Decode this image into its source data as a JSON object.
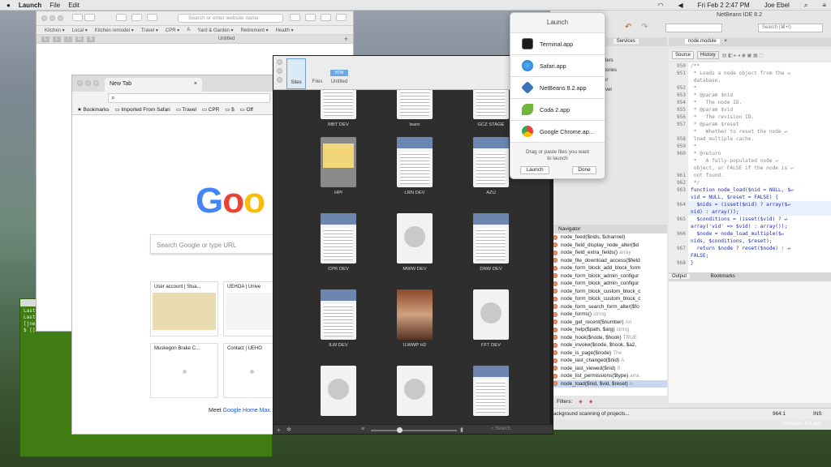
{
  "menubar": {
    "app": "Launch",
    "file": "File",
    "edit": "Edit",
    "datetime": "Fri Feb 2  2:47 PM",
    "user": "Joe Ebel"
  },
  "safari": {
    "address_placeholder": "Search or enter website name",
    "bookmarks": [
      "Kitchen ▾",
      "Local ▾",
      "Kitchen remodel ▾",
      "Travel ▾",
      "CPR ▾",
      "A",
      "Yard & Garden ▾",
      "Retirement ▾",
      "Health ▾"
    ],
    "tab_title": "Untitled",
    "tabicons": [
      "L",
      "L",
      "I",
      "G",
      "S"
    ]
  },
  "chrome": {
    "tab_title": "New Tab",
    "bookmarks": [
      "Bookmarks",
      "Imported From Safari",
      "Travel",
      "CPR",
      "$",
      "Off"
    ],
    "search_placeholder": "Search Google or type URL",
    "tiles": [
      "User account | Stua...",
      "UEHOA | Unive",
      "Muskegon Brake C...",
      "Contact | UEHO"
    ],
    "footer_prefix": "Meet ",
    "footer_link": "Google Home Max."
  },
  "terminal": {
    "lines": [
      "Last",
      "Last",
      "[jne",
      "$ []"
    ]
  },
  "coda": {
    "tabs": [
      "Sites",
      "Files",
      "Untitled"
    ],
    "tab3_badge": "HTM",
    "search_placeholder": "Search",
    "tiles": [
      "MBT DEV",
      "learn",
      "GCZ STAGE",
      "HPI",
      "LRN DEV",
      "AZU",
      "CPR DEV",
      "MWW DEV",
      "DNW DEV",
      "ILW DEV",
      "ILWWP H2",
      "FFT DEV",
      "",
      "",
      ""
    ]
  },
  "launch_popover": {
    "title": "Launch",
    "apps": [
      "Terminal.app",
      "Safari.app",
      "NetBeans 8.2.app",
      "Coda 2.app",
      "Google Chrome.ap..."
    ],
    "hint": "Drag or paste files you want to launch",
    "launch_button": "Launch",
    "done_button": "Done"
  },
  "netbeans": {
    "title": "NetBeans IDE 8.2",
    "search_placeholder": "Search (⌘+I)",
    "tabs": [
      "phd",
      "Services",
      "node.module"
    ],
    "source_tab": "Source",
    "history_tab": "History",
    "services_items": [
      "ders",
      "itories",
      "er",
      "rver"
    ],
    "navigator_title": "Navigator",
    "navigator_items": [
      {
        "n": "node_feed($nids, $channel)",
        "t": ""
      },
      {
        "n": "node_field_display_node_alter($d",
        "t": ""
      },
      {
        "n": "node_field_extra_fields()",
        "t": "array"
      },
      {
        "n": "node_file_download_access($field",
        "t": ""
      },
      {
        "n": "node_form_block_add_block_form",
        "t": ""
      },
      {
        "n": "node_form_block_admin_configur",
        "t": ""
      },
      {
        "n": "node_form_block_admin_configur",
        "t": ""
      },
      {
        "n": "node_form_block_custom_block_c",
        "t": ""
      },
      {
        "n": "node_form_block_custom_block_c",
        "t": ""
      },
      {
        "n": "node_form_search_form_alter($fo",
        "t": ""
      },
      {
        "n": "node_forms()",
        "t": "string"
      },
      {
        "n": "node_get_recent($number)",
        "t": "An"
      },
      {
        "n": "node_help($path, $arg)",
        "t": "string"
      },
      {
        "n": "node_hook($node, $hook)",
        "t": "TRUE"
      },
      {
        "n": "node_invoke($node, $hook, $a2,",
        "t": ""
      },
      {
        "n": "node_is_page($node)",
        "t": "The"
      },
      {
        "n": "node_last_changed($nid)",
        "t": "A"
      },
      {
        "n": "node_last_viewed($nid)",
        "t": "If"
      },
      {
        "n": "node_list_permissions($type)",
        "t": "arra"
      },
      {
        "n": "node_load($nid, $vid, $reset)",
        "t": "A"
      }
    ],
    "filters_label": "Filters:",
    "output_tab": "Output",
    "bookmarks_tab": "Bookmarks",
    "status_text": "ackground scanning of projects...",
    "cursor_pos": "964:1",
    "mode": "INS",
    "dock_label": "NetBeans 8.2.app",
    "line_numbers": [
      "950",
      "951",
      "",
      "952",
      "953",
      "954",
      "955",
      "956",
      "957",
      "",
      "958",
      "959",
      "960",
      "",
      "",
      "961",
      "962",
      "963",
      "",
      "964",
      "",
      "965",
      "",
      "966",
      "",
      "967",
      "",
      "968"
    ],
    "code_lines": [
      {
        "c": "cm",
        "s": "/**"
      },
      {
        "c": "cm",
        "s": " * Loads a node object from the ↵"
      },
      {
        "c": "cm",
        "s": " database."
      },
      {
        "c": "cm",
        "s": " *"
      },
      {
        "c": "cm",
        "s": " * @param $nid"
      },
      {
        "c": "cm",
        "s": " *   The node ID."
      },
      {
        "c": "cm",
        "s": " * @param $vid"
      },
      {
        "c": "cm",
        "s": " *   The revision ID."
      },
      {
        "c": "cm",
        "s": " * @param $reset"
      },
      {
        "c": "cm",
        "s": " *   Whether to reset the node_↵"
      },
      {
        "c": "cm",
        "s": " load_multiple cache."
      },
      {
        "c": "cm",
        "s": " *"
      },
      {
        "c": "cm",
        "s": " * @return"
      },
      {
        "c": "cm",
        "s": " *   A fully-populated node ↵"
      },
      {
        "c": "cm",
        "s": " object, or FALSE if the node is ↵"
      },
      {
        "c": "cm",
        "s": " not found."
      },
      {
        "c": "cm",
        "s": " */"
      },
      {
        "c": "kw",
        "s": "function node_load($nid = NULL, $↵"
      },
      {
        "c": "kw",
        "s": "vid = NULL, $reset = FALSE) {"
      },
      {
        "c": "kw",
        "s": "  $nids = (isset($nid) ? array($↵"
      },
      {
        "c": "kw",
        "s": "nid) : array());"
      },
      {
        "c": "kw",
        "s": "  $conditions = (isset($vid) ? ↵"
      },
      {
        "c": "kw",
        "s": "array('vid' => $vid) : array());"
      },
      {
        "c": "kw",
        "s": "  $node = node_load_multiple($↵"
      },
      {
        "c": "kw",
        "s": "nids, $conditions, $reset);"
      },
      {
        "c": "kw",
        "s": "  return $node ? reset($node) : ↵"
      },
      {
        "c": "kw",
        "s": "FALSE;"
      },
      {
        "c": "kw",
        "s": "}"
      }
    ]
  }
}
